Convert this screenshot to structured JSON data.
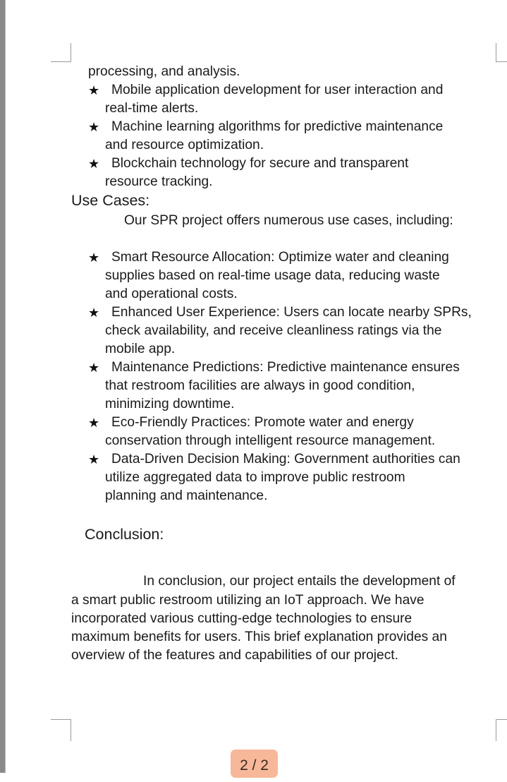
{
  "bullet_glyph": "★",
  "intro_tail": {
    "line1": "processing, and analysis."
  },
  "tech_items": [
    {
      "line1": "Mobile application development for user interaction and",
      "line2": "real-time alerts."
    },
    {
      "line1": "Machine learning algorithms for predictive maintenance",
      "line2": "and resource optimization."
    },
    {
      "line1": "Blockchain technology for secure and transparent",
      "line2": "resource tracking."
    }
  ],
  "use_cases": {
    "heading": "Use Cases:",
    "intro": "Our SPR project offers numerous use cases, including:",
    "items": [
      {
        "line1": "Smart Resource Allocation: Optimize water and cleaning",
        "line2": "supplies based on real-time usage data, reducing waste",
        "line3": "and operational costs."
      },
      {
        "line1": "Enhanced User Experience: Users can locate nearby SPRs,",
        "line2": "check availability, and receive cleanliness ratings via the",
        "line3": "mobile app."
      },
      {
        "line1": "Maintenance Predictions: Predictive maintenance ensures",
        "line2": "that restroom facilities are always in good condition,",
        "line3": "minimizing downtime."
      },
      {
        "line1": "Eco-Friendly Practices: Promote water and energy",
        "line2": "conservation through intelligent resource management."
      },
      {
        "line1": "Data-Driven Decision Making: Government authorities can",
        "line2": "utilize aggregated data to improve public restroom",
        "line3": "planning and maintenance."
      }
    ]
  },
  "conclusion": {
    "heading": "Conclusion:",
    "lines": [
      "In conclusion, our project entails the development of",
      "a smart public restroom utilizing an IoT approach. We have",
      "incorporated various cutting-edge technologies to ensure",
      "maximum benefits for users. This brief explanation provides an",
      "overview of the features and capabilities of our project."
    ]
  },
  "page_indicator": "2 / 2"
}
